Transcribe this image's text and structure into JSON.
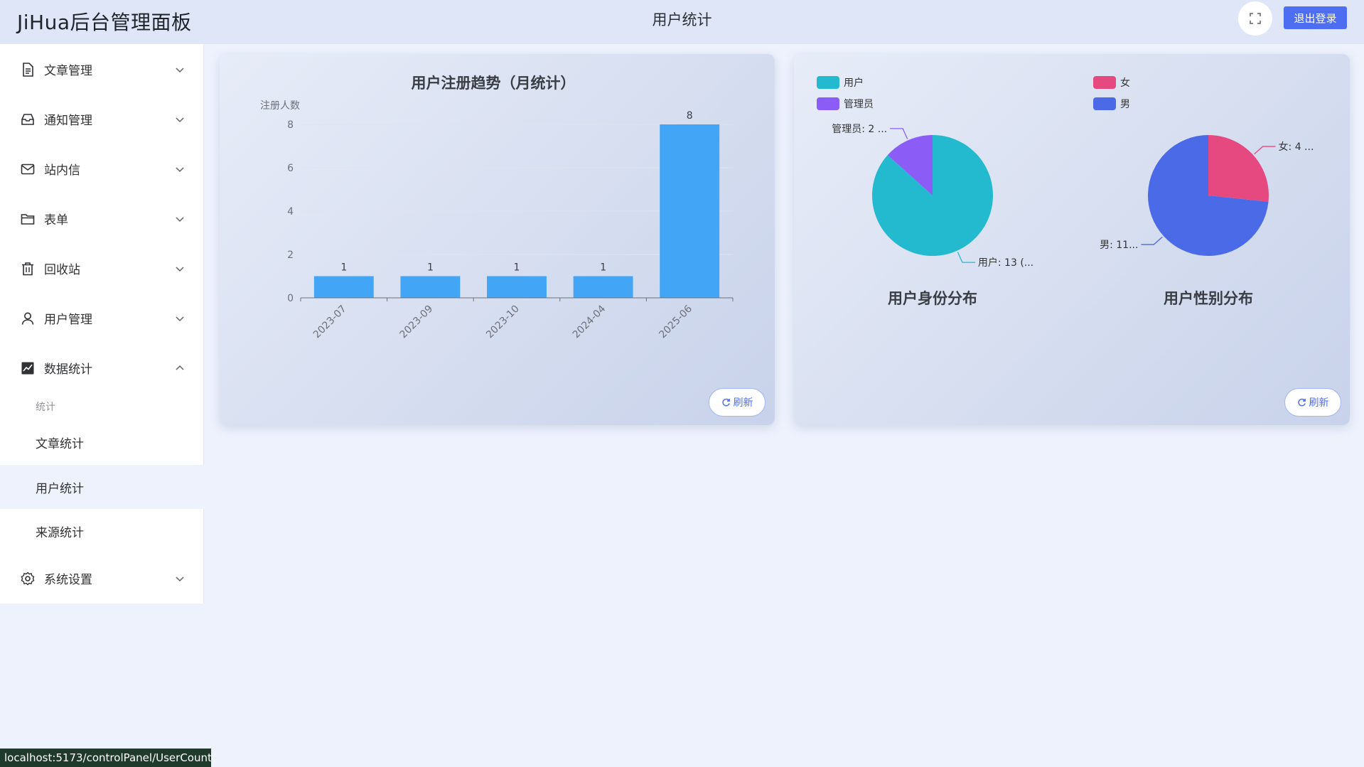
{
  "header": {
    "app_title": "JiHua后台管理面板",
    "page_title": "用户统计",
    "logout_label": "退出登录"
  },
  "sidebar": {
    "items": [
      {
        "label": "文章管理",
        "icon": "document-icon",
        "expanded": false
      },
      {
        "label": "通知管理",
        "icon": "inbox-icon",
        "expanded": false
      },
      {
        "label": "站内信",
        "icon": "mail-icon",
        "expanded": false
      },
      {
        "label": "表单",
        "icon": "folder-icon",
        "expanded": false
      },
      {
        "label": "回收站",
        "icon": "trash-icon",
        "expanded": false
      },
      {
        "label": "用户管理",
        "icon": "user-icon",
        "expanded": false
      },
      {
        "label": "数据统计",
        "icon": "chart-icon",
        "expanded": true
      },
      {
        "label": "系统设置",
        "icon": "gear-icon",
        "expanded": false
      }
    ],
    "stats_group_label": "统计",
    "stats_sub_items": [
      {
        "label": "文章统计",
        "active": false
      },
      {
        "label": "用户统计",
        "active": true
      },
      {
        "label": "来源统计",
        "active": false
      }
    ]
  },
  "refresh_label": "刷新",
  "status_url": "localhost:5173/controlPanel/UserCount",
  "colors": {
    "accent": "#4e6ef2",
    "bar": "#42a5f5",
    "user": "#23b9cf",
    "admin": "#8b5cf6",
    "female": "#e5497f",
    "male": "#4b6ae8"
  },
  "chart_data": [
    {
      "type": "bar",
      "title": "用户注册趋势（月统计）",
      "ylabel": "注册人数",
      "categories": [
        "2023-07",
        "2023-09",
        "2023-10",
        "2024-04",
        "2025-06"
      ],
      "values": [
        1,
        1,
        1,
        1,
        8
      ],
      "ylim": [
        0,
        8
      ],
      "yticks": [
        0,
        2,
        4,
        6,
        8
      ],
      "data_labels": true
    },
    {
      "type": "pie",
      "title": "用户身份分布",
      "slices": [
        {
          "name": "用户",
          "value": 13,
          "label": "用户: 13 (...",
          "color": "#23b9cf"
        },
        {
          "name": "管理员",
          "value": 2,
          "label": "管理员: 2 ...",
          "color": "#8b5cf6"
        }
      ]
    },
    {
      "type": "pie",
      "title": "用户性别分布",
      "slices": [
        {
          "name": "女",
          "value": 4,
          "label": "女: 4 ...",
          "color": "#e5497f"
        },
        {
          "name": "男",
          "value": 11,
          "label": "男: 11...",
          "color": "#4b6ae8"
        }
      ]
    }
  ]
}
